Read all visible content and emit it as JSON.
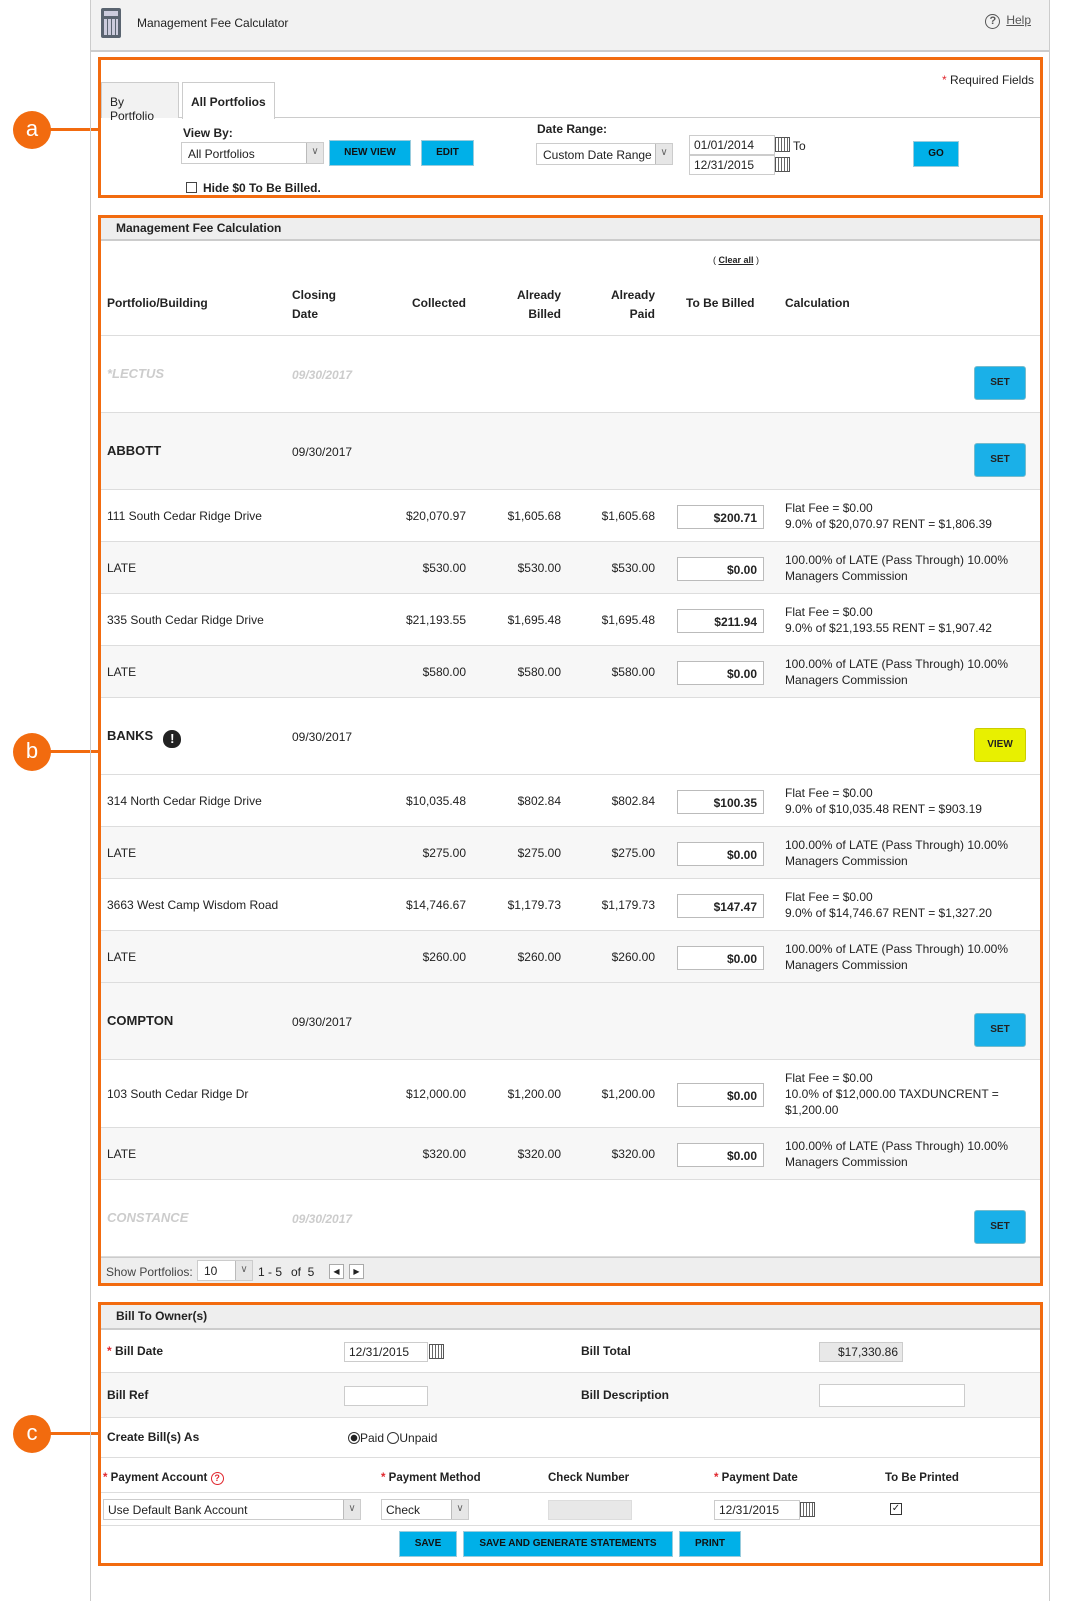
{
  "header": {
    "title": "Management Fee Calculator",
    "help": "Help"
  },
  "callouts": [
    "a",
    "b",
    "c"
  ],
  "filters": {
    "required": "Required Fields",
    "tabs": [
      "By Portfolio",
      "All Portfolios"
    ],
    "view_by_label": "View By:",
    "view_by_value": "All Portfolios",
    "new_view": "NEW VIEW",
    "edit": "EDIT",
    "date_range_label": "Date Range:",
    "date_range_value": "Custom Date Range",
    "from": "01/01/2014",
    "to_label": "To",
    "to": "12/31/2015",
    "go": "GO",
    "hide_zero": "Hide $0 To Be Billed.",
    "hide_zero_checked": false
  },
  "calc": {
    "title": "Management Fee Calculation",
    "clear_all": "Clear all",
    "columns": [
      "Portfolio/Building",
      "Closing Date",
      "Collected",
      "Already Billed",
      "Already Paid",
      "To Be Billed",
      "Calculation"
    ],
    "rows": [
      {
        "type": "portfolio",
        "name": "*LECTUS",
        "date": "09/30/2017",
        "faded": true,
        "button": "SET"
      },
      {
        "type": "portfolio",
        "name": "ABBOTT",
        "date": "09/30/2017",
        "button": "SET"
      },
      {
        "type": "item",
        "name": "111 South Cedar Ridge Drive",
        "collected": "$20,070.97",
        "billed": "$1,605.68",
        "paid": "$1,605.68",
        "to_bill": "$200.71",
        "calc": [
          "Flat Fee = $0.00",
          "9.0% of $20,070.97 RENT = $1,806.39"
        ]
      },
      {
        "type": "item",
        "name": "LATE",
        "collected": "$530.00",
        "billed": "$530.00",
        "paid": "$530.00",
        "to_bill": "$0.00",
        "calc": [
          "100.00% of LATE (Pass Through) 10.00%",
          "Managers Commission"
        ]
      },
      {
        "type": "item",
        "name": "335 South Cedar Ridge Drive",
        "collected": "$21,193.55",
        "billed": "$1,695.48",
        "paid": "$1,695.48",
        "to_bill": "$211.94",
        "calc": [
          "Flat Fee = $0.00",
          "9.0% of $21,193.55 RENT = $1,907.42"
        ]
      },
      {
        "type": "item",
        "name": "LATE",
        "collected": "$580.00",
        "billed": "$580.00",
        "paid": "$580.00",
        "to_bill": "$0.00",
        "calc": [
          "100.00% of LATE (Pass Through) 10.00%",
          "Managers Commission"
        ]
      },
      {
        "type": "portfolio",
        "name": "BANKS",
        "date": "09/30/2017",
        "warning": true,
        "button": "VIEW"
      },
      {
        "type": "item",
        "name": "314 North Cedar Ridge Drive",
        "collected": "$10,035.48",
        "billed": "$802.84",
        "paid": "$802.84",
        "to_bill": "$100.35",
        "calc": [
          "Flat Fee = $0.00",
          "9.0% of $10,035.48 RENT = $903.19"
        ]
      },
      {
        "type": "item",
        "name": "LATE",
        "collected": "$275.00",
        "billed": "$275.00",
        "paid": "$275.00",
        "to_bill": "$0.00",
        "calc": [
          "100.00% of LATE (Pass Through) 10.00%",
          "Managers Commission"
        ]
      },
      {
        "type": "item",
        "name": "3663 West Camp Wisdom Road",
        "collected": "$14,746.67",
        "billed": "$1,179.73",
        "paid": "$1,179.73",
        "to_bill": "$147.47",
        "calc": [
          "Flat Fee = $0.00",
          "9.0% of $14,746.67 RENT = $1,327.20"
        ]
      },
      {
        "type": "item",
        "name": "LATE",
        "collected": "$260.00",
        "billed": "$260.00",
        "paid": "$260.00",
        "to_bill": "$0.00",
        "calc": [
          "100.00% of LATE (Pass Through) 10.00%",
          "Managers Commission"
        ]
      },
      {
        "type": "portfolio",
        "name": "COMPTON",
        "date": "09/30/2017",
        "button": "SET"
      },
      {
        "type": "item",
        "name": "103 South Cedar Ridge Dr",
        "collected": "$12,000.00",
        "billed": "$1,200.00",
        "paid": "$1,200.00",
        "to_bill": "$0.00",
        "calc": [
          "Flat Fee = $0.00",
          "10.0% of $12,000.00 TAXDUNCRENT =",
          "$1,200.00"
        ]
      },
      {
        "type": "item",
        "name": "LATE",
        "collected": "$320.00",
        "billed": "$320.00",
        "paid": "$320.00",
        "to_bill": "$0.00",
        "calc": [
          "100.00% of LATE (Pass Through) 10.00%",
          "Managers Commission"
        ]
      },
      {
        "type": "portfolio",
        "name": "CONSTANCE",
        "date": "09/30/2017",
        "faded": true,
        "button": "SET"
      }
    ],
    "footer": {
      "show_label": "Show Portfolios:",
      "show_value": "10",
      "range": "1 - 5",
      "of": "of  5"
    }
  },
  "bill": {
    "title": "Bill To Owner(s)",
    "bill_date_label": "Bill Date",
    "bill_date": "12/31/2015",
    "bill_total_label": "Bill Total",
    "bill_total": "$17,330.86",
    "bill_ref_label": "Bill Ref",
    "bill_ref": "",
    "bill_desc_label": "Bill Description",
    "bill_desc": "",
    "create_as_label": "Create Bill(s) As",
    "paid": "Paid",
    "unpaid": "Unpaid",
    "selected": "Paid",
    "payment_account_label": "Payment Account",
    "payment_method_label": "Payment Method",
    "check_number_label": "Check Number",
    "payment_date_label": "Payment Date",
    "to_be_printed_label": "To Be Printed",
    "payment_account": "Use Default Bank Account",
    "payment_method": "Check",
    "check_number": "",
    "payment_date": "12/31/2015",
    "to_be_printed": true,
    "save": "SAVE",
    "save_generate": "SAVE AND GENERATE STATEMENTS",
    "print": "PRINT"
  },
  "colors": {
    "accent": "#00b0e8",
    "annotation": "#f26b0f",
    "view_button": "#e8f000"
  }
}
